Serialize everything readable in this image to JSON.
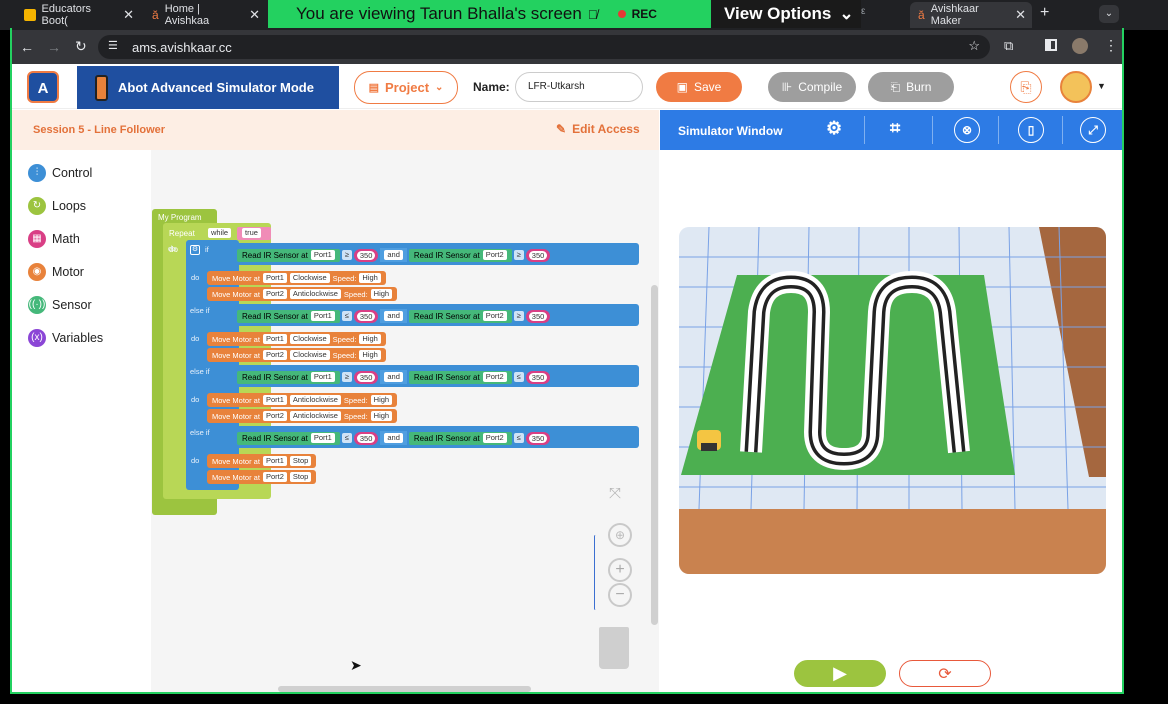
{
  "browser": {
    "tabs": [
      {
        "label": "Educators Boot("
      },
      {
        "label": "Home | Avishkaa"
      },
      {
        "label": "Avishkaar Maker"
      }
    ],
    "tab_hidden_label": "ε",
    "url": "ams.avishkaar.cc"
  },
  "zoom": {
    "viewing": "You are viewing  Tarun Bhalla's screen",
    "rec": "REC",
    "view_options": "View Options"
  },
  "header": {
    "mode_title": "Abot Advanced Simulator Mode",
    "project_label": "Project",
    "name_label": "Name:",
    "name_value": "LFR-Utkarsh",
    "save_label": "Save",
    "compile_label": "Compile",
    "burn_label": "Burn"
  },
  "session": {
    "title": "Session 5 - Line Follower",
    "edit_access": "Edit Access"
  },
  "simulator": {
    "title": "Simulator Window"
  },
  "sidebar": {
    "items": [
      {
        "label": "Control",
        "color": "#3d8fd6"
      },
      {
        "label": "Loops",
        "color": "#9cc43f"
      },
      {
        "label": "Math",
        "color": "#d93f85"
      },
      {
        "label": "Motor",
        "color": "#e8823b"
      },
      {
        "label": "Sensor",
        "color": "#45b87a"
      },
      {
        "label": "Variables",
        "color": "#8b46d6"
      }
    ]
  },
  "program": {
    "title": "My Program",
    "repeat": "Repeat",
    "while": "while",
    "true": "true",
    "do": "do",
    "if": "if",
    "else_if": "else if",
    "and": "and",
    "read_ir": "Read IR Sensor at",
    "move_motor": "Move Motor at",
    "speed": "Speed:",
    "conditions": [
      {
        "p1": "Port1",
        "op1": "≥",
        "v1": "350",
        "p2": "Port2",
        "op2": "≥",
        "v2": "350",
        "motors": [
          {
            "port": "Port1",
            "dir": "Clockwise",
            "speed": "High"
          },
          {
            "port": "Port2",
            "dir": "Anticlockwise",
            "speed": "High"
          }
        ]
      },
      {
        "p1": "Port1",
        "op1": "≤",
        "v1": "350",
        "p2": "Port2",
        "op2": "≥",
        "v2": "350",
        "motors": [
          {
            "port": "Port1",
            "dir": "Clockwise",
            "speed": "High"
          },
          {
            "port": "Port2",
            "dir": "Clockwise",
            "speed": "High"
          }
        ]
      },
      {
        "p1": "Port1",
        "op1": "≥",
        "v1": "350",
        "p2": "Port2",
        "op2": "≤",
        "v2": "350",
        "motors": [
          {
            "port": "Port1",
            "dir": "Anticlockwise",
            "speed": "High"
          },
          {
            "port": "Port2",
            "dir": "Anticlockwise",
            "speed": "High"
          }
        ]
      },
      {
        "p1": "Port1",
        "op1": "≤",
        "v1": "350",
        "p2": "Port2",
        "op2": "≤",
        "v2": "350",
        "motors": [
          {
            "port": "Port1",
            "dir": "Stop"
          },
          {
            "port": "Port2",
            "dir": "Stop"
          }
        ]
      }
    ]
  },
  "colors": {
    "brand_blue": "#1f4fa0",
    "accent_orange": "#f07b43",
    "sim_header": "#2d7be5",
    "zoom_green": "#23d160"
  }
}
